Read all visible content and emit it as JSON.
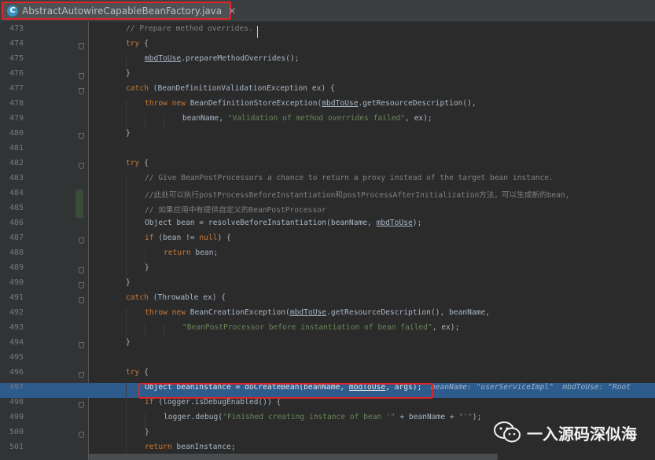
{
  "tab": {
    "icon_letter": "C",
    "title": "AbstractAutowireCapableBeanFactory.java",
    "close": "✕"
  },
  "current_line": 497,
  "lines": [
    {
      "n": "473",
      "ind": 2,
      "segs": [
        [
          "cmt",
          "// Prepare method overrides."
        ]
      ]
    },
    {
      "n": "474",
      "ind": 2,
      "segs": [
        [
          "kw",
          "try"
        ],
        [
          "txt",
          " {"
        ]
      ]
    },
    {
      "n": "475",
      "ind": 3,
      "segs": [
        [
          "u",
          "mbdToUse"
        ],
        [
          "txt",
          ".prepareMethodOverrides();"
        ]
      ]
    },
    {
      "n": "476",
      "ind": 2,
      "segs": [
        [
          "txt",
          "}"
        ]
      ]
    },
    {
      "n": "477",
      "ind": 2,
      "segs": [
        [
          "kw",
          "catch"
        ],
        [
          "txt",
          " (BeanDefinitionValidationException ex) {"
        ]
      ]
    },
    {
      "n": "478",
      "ind": 3,
      "segs": [
        [
          "kw",
          "throw new"
        ],
        [
          "txt",
          " BeanDefinitionStoreException("
        ],
        [
          "u",
          "mbdToUse"
        ],
        [
          "txt",
          ".getResourceDescription(),"
        ]
      ]
    },
    {
      "n": "479",
      "ind": 5,
      "segs": [
        [
          "txt",
          "beanName, "
        ],
        [
          "str",
          "\"Validation of method overrides failed\""
        ],
        [
          "txt",
          ", ex);"
        ]
      ]
    },
    {
      "n": "480",
      "ind": 2,
      "segs": [
        [
          "txt",
          "}"
        ]
      ]
    },
    {
      "n": "481",
      "ind": 0,
      "segs": []
    },
    {
      "n": "482",
      "ind": 2,
      "segs": [
        [
          "kw",
          "try"
        ],
        [
          "txt",
          " {"
        ]
      ]
    },
    {
      "n": "483",
      "ind": 3,
      "segs": [
        [
          "cmt",
          "// Give BeanPostProcessors a chance to return a proxy instead of the target bean instance."
        ]
      ]
    },
    {
      "n": "484",
      "ind": 3,
      "segs": [
        [
          "cmt",
          "//此处可以执行postProcessBeforeInstantiation和postProcessAfterInitialization方法，可以生成新的bean,"
        ]
      ]
    },
    {
      "n": "485",
      "ind": 3,
      "segs": [
        [
          "cmt",
          "// 如果应用中有提供自定义的BeanPostProcessor"
        ]
      ]
    },
    {
      "n": "486",
      "ind": 3,
      "segs": [
        [
          "txt",
          "Object bean = resolveBeforeInstantiation(beanName, "
        ],
        [
          "u",
          "mbdToUse"
        ],
        [
          "txt",
          ");"
        ]
      ]
    },
    {
      "n": "487",
      "ind": 3,
      "segs": [
        [
          "kw",
          "if"
        ],
        [
          "txt",
          " (bean != "
        ],
        [
          "kw",
          "null"
        ],
        [
          "txt",
          ") {"
        ]
      ]
    },
    {
      "n": "488",
      "ind": 4,
      "segs": [
        [
          "kw",
          "return"
        ],
        [
          "txt",
          " bean;"
        ]
      ]
    },
    {
      "n": "489",
      "ind": 3,
      "segs": [
        [
          "txt",
          "}"
        ]
      ]
    },
    {
      "n": "490",
      "ind": 2,
      "segs": [
        [
          "txt",
          "}"
        ]
      ]
    },
    {
      "n": "491",
      "ind": 2,
      "segs": [
        [
          "kw",
          "catch"
        ],
        [
          "txt",
          " (Throwable ex) {"
        ]
      ]
    },
    {
      "n": "492",
      "ind": 3,
      "segs": [
        [
          "kw",
          "throw new"
        ],
        [
          "txt",
          " BeanCreationException("
        ],
        [
          "u",
          "mbdToUse"
        ],
        [
          "txt",
          ".getResourceDescription(), beanName,"
        ]
      ]
    },
    {
      "n": "493",
      "ind": 5,
      "segs": [
        [
          "str",
          "\"BeanPostProcessor before instantiation of bean failed\""
        ],
        [
          "txt",
          ", ex);"
        ]
      ]
    },
    {
      "n": "494",
      "ind": 2,
      "segs": [
        [
          "txt",
          "}"
        ]
      ]
    },
    {
      "n": "495",
      "ind": 0,
      "segs": []
    },
    {
      "n": "496",
      "ind": 2,
      "segs": [
        [
          "kw",
          "try"
        ],
        [
          "txt",
          " {"
        ]
      ]
    },
    {
      "n": "497",
      "ind": 3,
      "segs": [
        [
          "txt",
          "Object beanInstance = doCreateBean(beanName, "
        ],
        [
          "u",
          "mbdToUse"
        ],
        [
          "txt",
          ", args);"
        ],
        [
          "hint",
          "  beanName: \"userServiceImpl\"  mbdToUse: \"Root"
        ]
      ]
    },
    {
      "n": "498",
      "ind": 3,
      "segs": [
        [
          "kw",
          "if"
        ],
        [
          "txt",
          " (logger.isDebugEnabled()) {"
        ]
      ]
    },
    {
      "n": "499",
      "ind": 4,
      "segs": [
        [
          "txt",
          "logger.debug("
        ],
        [
          "str",
          "\"Finished creating instance of bean '\""
        ],
        [
          "txt",
          " + beanName + "
        ],
        [
          "str",
          "\"'\""
        ],
        [
          "txt",
          ");"
        ]
      ]
    },
    {
      "n": "500",
      "ind": 3,
      "segs": [
        [
          "txt",
          "}"
        ]
      ]
    },
    {
      "n": "501",
      "ind": 3,
      "segs": [
        [
          "kw",
          "return"
        ],
        [
          "txt",
          " beanInstance;"
        ]
      ]
    }
  ],
  "watermark": {
    "text": "一入源码深似海"
  },
  "colors": {
    "keyword": "#cc7832",
    "comment": "#808080",
    "string": "#6a8759",
    "text": "#a9b7c6",
    "current_line": "#2d5b8c",
    "highlight_box": "#e0242b"
  }
}
